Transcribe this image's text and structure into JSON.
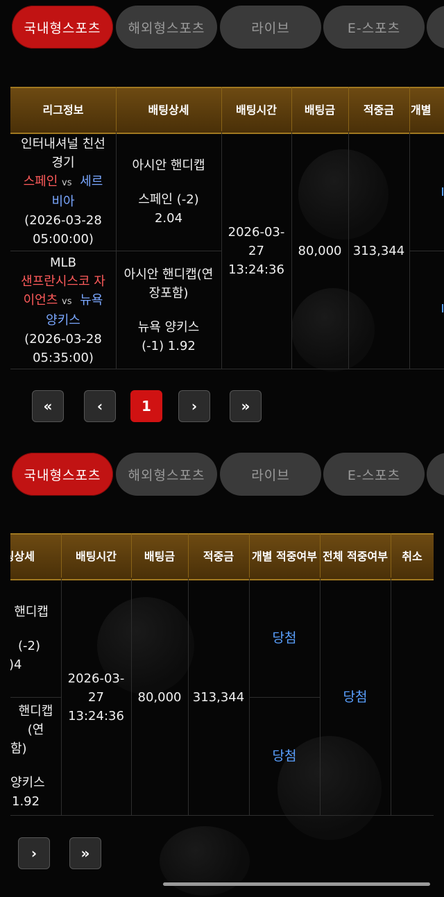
{
  "tabs": {
    "items": [
      "국내형스포츠",
      "해외형스포츠",
      "라이브",
      "E-스포츠"
    ],
    "active": "국내형스포츠"
  },
  "table": {
    "headers": {
      "league": "리그정보",
      "detail": "배팅상세",
      "time": "배팅시간",
      "amount": "배팅금",
      "payout": "적중금",
      "individual": "개별 적중여부",
      "individual_short": "개별",
      "overall": "전체 적중여부",
      "cancel": "취소"
    },
    "bet": {
      "time_line1": "2026-03-",
      "time_line2": "27",
      "time_line3": "13:24:36",
      "amount": "80,000",
      "payout": "313,344",
      "overall_result": "당첨"
    },
    "rows": [
      {
        "league_line1": "인터내셔널 친선",
        "league_line2": "경기",
        "home": "스페인",
        "vs": "vs",
        "away_part1": "세르",
        "away_part2": "비아",
        "date_line1": "(2026-03-28",
        "date_line2": "05:00:00)",
        "detail_type": "아시안 핸디캡",
        "pick_line1": "스페인  (-2)",
        "pick_line2": "2.04",
        "result": "당첨",
        "cut_type": "핸디캡",
        "cut_pick1": "(-2)",
        "cut_pick2": ")4"
      },
      {
        "league_line1": "MLB",
        "home_part1": "샌프란시스코 자",
        "home_part2": "이언츠",
        "vs": "vs",
        "away_part1": "뉴욕",
        "away_part2": "양키스",
        "date_line1": "(2026-03-28",
        "date_line2": "05:35:00)",
        "detail_type1": "아시안 핸디캡(연",
        "detail_type2": "장포함)",
        "pick_line1": "뉴욕  양키스",
        "pick_line2": "(-1)  1.92",
        "result": "당첨",
        "cut_type1": "핸디캡(연",
        "cut_type2": "함)",
        "cut_pick1": "양키스",
        "cut_pick2": "1.92"
      }
    ]
  },
  "pagination": {
    "first": "«",
    "prev": "‹",
    "current": "1",
    "next": "›",
    "last": "»"
  }
}
